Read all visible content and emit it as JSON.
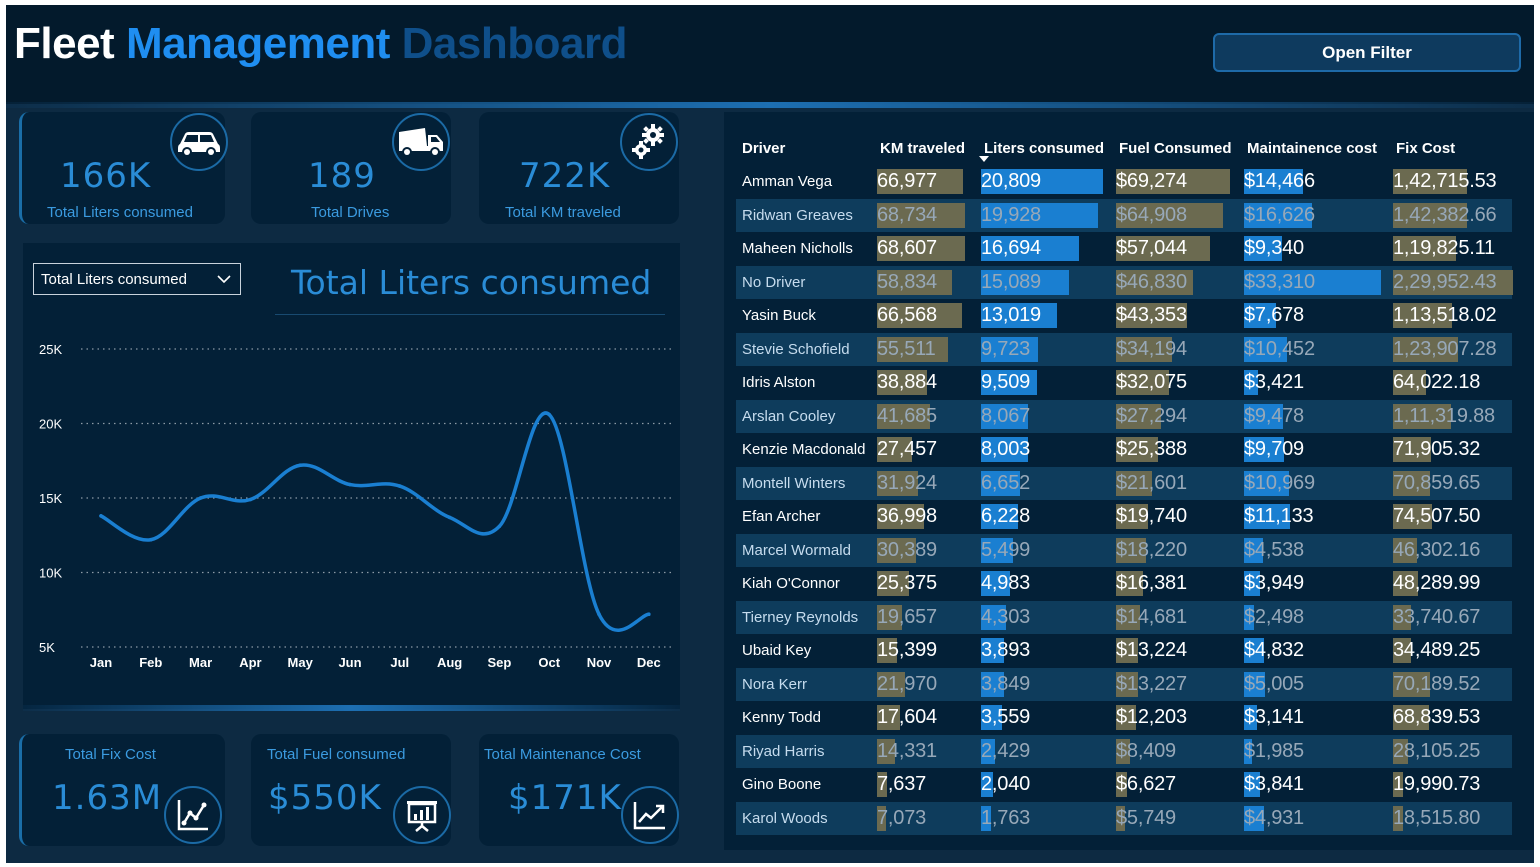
{
  "header": {
    "title_part1": "Fleet",
    "title_part2": "Management",
    "title_part3": "Dashboard",
    "open_filter_label": "Open Filter"
  },
  "kpis_top": [
    {
      "value": "166K",
      "label": "Total Liters consumed",
      "icon": "car-icon"
    },
    {
      "value": "189",
      "label": "Total Drives",
      "icon": "truck-icon"
    },
    {
      "value": "722K",
      "label": "Total KM traveled",
      "icon": "gears-icon"
    }
  ],
  "kpis_bottom": [
    {
      "value": "1.63M",
      "label": "Total Fix Cost",
      "icon": "line-chart-icon"
    },
    {
      "value": "$550K",
      "label": "Total Fuel consumed",
      "icon": "presentation-icon"
    },
    {
      "value": "$171K",
      "label": "Total Maintenance Cost",
      "icon": "trend-up-icon"
    }
  ],
  "chart": {
    "dropdown_value": "Total Liters consumed",
    "title": "Total Liters consumed"
  },
  "chart_data": {
    "type": "line",
    "title": "Total Liters consumed",
    "categories": [
      "Jan",
      "Feb",
      "Mar",
      "Apr",
      "May",
      "Jun",
      "Jul",
      "Aug",
      "Sep",
      "Oct",
      "Nov",
      "Dec"
    ],
    "values": [
      13800,
      12200,
      15000,
      14900,
      17200,
      15900,
      15800,
      13700,
      13100,
      20600,
      7200,
      7200
    ],
    "yticks": [
      5000,
      10000,
      15000,
      20000,
      25000
    ],
    "ytick_labels": [
      "5K",
      "10K",
      "15K",
      "20K",
      "25K"
    ],
    "ylim": [
      5000,
      25000
    ],
    "grid": true,
    "color": "#1a7fd1"
  },
  "table": {
    "columns": [
      "Driver",
      "KM traveled",
      "Liters consumed",
      "Fuel Consumed",
      "Maintainence cost",
      "Fix Cost"
    ],
    "sorted_column": "Liters consumed",
    "rows": [
      {
        "driver": "Amman Vega",
        "km": "66,977",
        "km_v": 66977,
        "liters": "20,809",
        "liters_v": 20809,
        "fuel": "$69,274",
        "fuel_v": 69274,
        "maint": "$14,466",
        "maint_v": 14466,
        "fix": "1,42,715.53",
        "fix_v": 142715.53
      },
      {
        "driver": "Ridwan Greaves",
        "km": "68,734",
        "km_v": 68734,
        "liters": "19,928",
        "liters_v": 19928,
        "fuel": "$64,908",
        "fuel_v": 64908,
        "maint": "$16,626",
        "maint_v": 16626,
        "fix": "1,42,382.66",
        "fix_v": 142382.66
      },
      {
        "driver": "Maheen Nicholls",
        "km": "68,607",
        "km_v": 68607,
        "liters": "16,694",
        "liters_v": 16694,
        "fuel": "$57,044",
        "fuel_v": 57044,
        "maint": "$9,340",
        "maint_v": 9340,
        "fix": "1,19,825.11",
        "fix_v": 119825.11
      },
      {
        "driver": "No Driver",
        "km": "58,834",
        "km_v": 58834,
        "liters": "15,089",
        "liters_v": 15089,
        "fuel": "$46,830",
        "fuel_v": 46830,
        "maint": "$33,310",
        "maint_v": 33310,
        "fix": "2,29,952.43",
        "fix_v": 229952.43
      },
      {
        "driver": "Yasin Buck",
        "km": "66,568",
        "km_v": 66568,
        "liters": "13,019",
        "liters_v": 13019,
        "fuel": "$43,353",
        "fuel_v": 43353,
        "maint": "$7,678",
        "maint_v": 7678,
        "fix": "1,13,518.02",
        "fix_v": 113518.02
      },
      {
        "driver": "Stevie Schofield",
        "km": "55,511",
        "km_v": 55511,
        "liters": "9,723",
        "liters_v": 9723,
        "fuel": "$34,194",
        "fuel_v": 34194,
        "maint": "$10,452",
        "maint_v": 10452,
        "fix": "1,23,907.28",
        "fix_v": 123907.28
      },
      {
        "driver": "Idris Alston",
        "km": "38,884",
        "km_v": 38884,
        "liters": "9,509",
        "liters_v": 9509,
        "fuel": "$32,075",
        "fuel_v": 32075,
        "maint": "$3,421",
        "maint_v": 3421,
        "fix": "64,022.18",
        "fix_v": 64022.18
      },
      {
        "driver": "Arslan Cooley",
        "km": "41,685",
        "km_v": 41685,
        "liters": "8,067",
        "liters_v": 8067,
        "fuel": "$27,294",
        "fuel_v": 27294,
        "maint": "$9,478",
        "maint_v": 9478,
        "fix": "1,11,319.88",
        "fix_v": 111319.88
      },
      {
        "driver": "Kenzie Macdonald",
        "km": "27,457",
        "km_v": 27457,
        "liters": "8,003",
        "liters_v": 8003,
        "fuel": "$25,388",
        "fuel_v": 25388,
        "maint": "$9,709",
        "maint_v": 9709,
        "fix": "71,905.32",
        "fix_v": 71905.32
      },
      {
        "driver": "Montell Winters",
        "km": "31,924",
        "km_v": 31924,
        "liters": "6,652",
        "liters_v": 6652,
        "fuel": "$21,601",
        "fuel_v": 21601,
        "maint": "$10,969",
        "maint_v": 10969,
        "fix": "70,859.65",
        "fix_v": 70859.65
      },
      {
        "driver": "Efan Archer",
        "km": "36,998",
        "km_v": 36998,
        "liters": "6,228",
        "liters_v": 6228,
        "fuel": "$19,740",
        "fuel_v": 19740,
        "maint": "$11,133",
        "maint_v": 11133,
        "fix": "74,507.50",
        "fix_v": 74507.5
      },
      {
        "driver": "Marcel Wormald",
        "km": "30,389",
        "km_v": 30389,
        "liters": "5,499",
        "liters_v": 5499,
        "fuel": "$18,220",
        "fuel_v": 18220,
        "maint": "$4,538",
        "maint_v": 4538,
        "fix": "46,302.16",
        "fix_v": 46302.16
      },
      {
        "driver": "Kiah O'Connor",
        "km": "25,375",
        "km_v": 25375,
        "liters": "4,983",
        "liters_v": 4983,
        "fuel": "$16,381",
        "fuel_v": 16381,
        "maint": "$3,949",
        "maint_v": 3949,
        "fix": "48,289.99",
        "fix_v": 48289.99
      },
      {
        "driver": "Tierney Reynolds",
        "km": "19,657",
        "km_v": 19657,
        "liters": "4,303",
        "liters_v": 4303,
        "fuel": "$14,681",
        "fuel_v": 14681,
        "maint": "$2,498",
        "maint_v": 2498,
        "fix": "33,740.67",
        "fix_v": 33740.67
      },
      {
        "driver": "Ubaid Key",
        "km": "15,399",
        "km_v": 15399,
        "liters": "3,893",
        "liters_v": 3893,
        "fuel": "$13,224",
        "fuel_v": 13224,
        "maint": "$4,832",
        "maint_v": 4832,
        "fix": "34,489.25",
        "fix_v": 34489.25
      },
      {
        "driver": "Nora Kerr",
        "km": "21,970",
        "km_v": 21970,
        "liters": "3,849",
        "liters_v": 3849,
        "fuel": "$13,227",
        "fuel_v": 13227,
        "maint": "$5,005",
        "maint_v": 5005,
        "fix": "70,189.52",
        "fix_v": 70189.52
      },
      {
        "driver": "Kenny Todd",
        "km": "17,604",
        "km_v": 17604,
        "liters": "3,559",
        "liters_v": 3559,
        "fuel": "$12,203",
        "fuel_v": 12203,
        "maint": "$3,141",
        "maint_v": 3141,
        "fix": "68,839.53",
        "fix_v": 68839.53
      },
      {
        "driver": "Riyad Harris",
        "km": "14,331",
        "km_v": 14331,
        "liters": "2,429",
        "liters_v": 2429,
        "fuel": "$8,409",
        "fuel_v": 8409,
        "maint": "$1,985",
        "maint_v": 1985,
        "fix": "28,105.25",
        "fix_v": 28105.25
      },
      {
        "driver": "Gino Boone",
        "km": "7,637",
        "km_v": 7637,
        "liters": "2,040",
        "liters_v": 2040,
        "fuel": "$6,627",
        "fuel_v": 6627,
        "maint": "$3,841",
        "maint_v": 3841,
        "fix": "19,990.73",
        "fix_v": 19990.73
      },
      {
        "driver": "Karol Woods",
        "km": "7,073",
        "km_v": 7073,
        "liters": "1,763",
        "liters_v": 1763,
        "fuel": "$5,749",
        "fuel_v": 5749,
        "maint": "$4,931",
        "maint_v": 4931,
        "fix": "18,515.80",
        "fix_v": 18515.8
      }
    ]
  },
  "colors": {
    "accent": "#1f8ef1",
    "bar_olive": "#6b6a50",
    "bar_blue": "#1a7fd1",
    "panel": "#032037",
    "background": "#0d2a42"
  }
}
